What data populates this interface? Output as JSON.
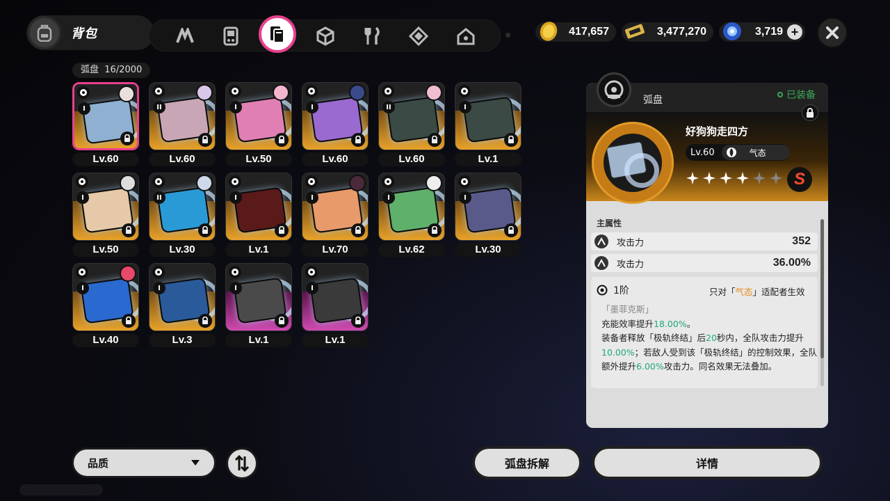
{
  "header": {
    "title": "背包",
    "tabs": [
      "signal",
      "gamepad",
      "drive-disc",
      "box",
      "food",
      "material",
      "home"
    ],
    "active_tab": "drive-disc"
  },
  "currencies": [
    {
      "name": "coin",
      "value": "417,657"
    },
    {
      "name": "ticket",
      "value": "3,477,270"
    },
    {
      "name": "polychrome",
      "value": "3,719"
    }
  ],
  "inventory": {
    "count_label": "弧盘",
    "count_value": "16/2000",
    "items": [
      {
        "level": "Lv.60",
        "rank": "I",
        "rarity": "orange",
        "art": "#8fb0d0"
      },
      {
        "level": "Lv.60",
        "rank": "II",
        "rarity": "orange",
        "art": "#c9a6b5"
      },
      {
        "level": "Lv.50",
        "rank": "I",
        "rarity": "orange",
        "art": "#e07fb3"
      },
      {
        "level": "Lv.60",
        "rank": "I",
        "rarity": "orange",
        "art": "#9a6ad0"
      },
      {
        "level": "Lv.60",
        "rank": "II",
        "rarity": "orange",
        "art": "#3a4a44"
      },
      {
        "level": "Lv.1",
        "rank": "I",
        "rarity": "orange",
        "art": "#3b4a44"
      },
      {
        "level": "Lv.50",
        "rank": "I",
        "rarity": "orange",
        "art": "#e6c9a8"
      },
      {
        "level": "Lv.30",
        "rank": "II",
        "rarity": "orange",
        "art": "#2a9ad6"
      },
      {
        "level": "Lv.1",
        "rank": "I",
        "rarity": "orange",
        "art": "#5a1a1a"
      },
      {
        "level": "Lv.70",
        "rank": "I",
        "rarity": "orange",
        "art": "#e89a6a"
      },
      {
        "level": "Lv.62",
        "rank": "I",
        "rarity": "orange",
        "art": "#5fb06a"
      },
      {
        "level": "Lv.30",
        "rank": "I",
        "rarity": "orange",
        "art": "#5a5a8a"
      },
      {
        "level": "Lv.40",
        "rank": "I",
        "rarity": "orange",
        "art": "#2a6ad0"
      },
      {
        "level": "Lv.3",
        "rank": "I",
        "rarity": "orange",
        "art": "#2a5a9a"
      },
      {
        "level": "Lv.1",
        "rank": "I",
        "rarity": "purple",
        "art": "#4a4a4a"
      },
      {
        "level": "Lv.1",
        "rank": "I",
        "rarity": "purple",
        "art": "#3a3a3a"
      }
    ]
  },
  "detail": {
    "category": "弧盘",
    "equipped": "已装备",
    "name": "好狗狗走四方",
    "level": "Lv.60",
    "attribute": "气态",
    "stars_filled": 4,
    "stars_total": 6,
    "grade": "S",
    "main_stat_title": "主属性",
    "stats": [
      {
        "name": "攻击力",
        "value": "352"
      },
      {
        "name": "攻击力",
        "value": "36.00%"
      }
    ],
    "rank": "1阶",
    "condition_pre": "只对「",
    "condition_attr": "气态",
    "condition_post": "」适配者生效",
    "set_name": "「墨菲克斯」",
    "desc_1a": "充能效率提升",
    "desc_1b": "18.00%",
    "desc_1c": "。",
    "desc_2a": "装备者释放「极轨终结」后",
    "desc_2b": "20",
    "desc_2c": "秒内，全队攻击力提升",
    "desc_2d": "10.00%",
    "desc_2e": "；若敌人受到该「极轨终结」的控制效果，全队额外提升",
    "desc_2f": "6.00%",
    "desc_2g": "攻击力。同名效果无法叠加。"
  },
  "bottom": {
    "sort_label": "品质",
    "dismantle_label": "弧盘拆解",
    "details_label": "详情"
  },
  "colors": {
    "accent_pink": "#e8408d",
    "rarity_orange": "#e8a22a",
    "rarity_purple": "#d04ab0",
    "highlight_green": "#1fa879",
    "attribute_orange": "#e88a1a"
  }
}
